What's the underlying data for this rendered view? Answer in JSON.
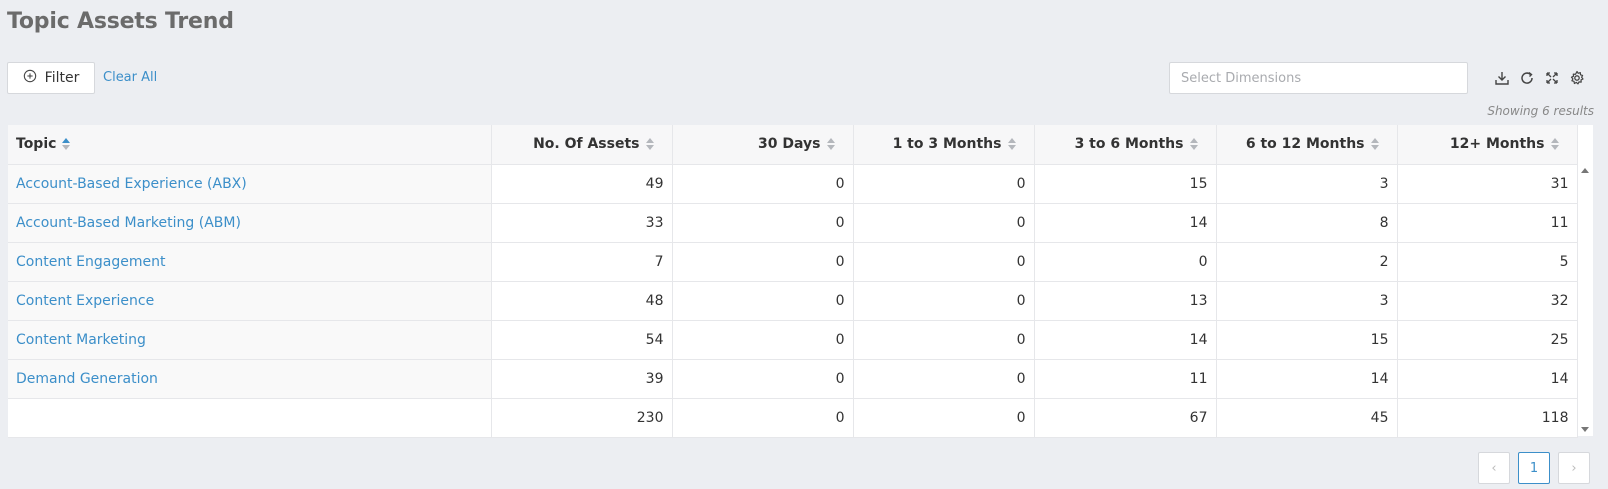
{
  "page": {
    "title": "Topic Assets Trend"
  },
  "toolbar": {
    "filter_label": "Filter",
    "clear_all_label": "Clear All",
    "dimensions_placeholder": "Select Dimensions",
    "icons": [
      "download-icon",
      "refresh-icon",
      "fullscreen-icon",
      "settings-icon"
    ]
  },
  "results": {
    "showing_text": "Showing 6 results"
  },
  "table": {
    "columns": [
      "Topic",
      "No. Of Assets",
      "30 Days",
      "1 to 3 Months",
      "3 to 6 Months",
      "6 to 12 Months",
      "12+ Months"
    ],
    "sorted_column": "Topic",
    "sort_direction": "ascending",
    "rows": [
      [
        "Account-Based Experience (ABX)",
        "49",
        "0",
        "0",
        "15",
        "3",
        "31"
      ],
      [
        "Account-Based Marketing (ABM)",
        "33",
        "0",
        "0",
        "14",
        "8",
        "11"
      ],
      [
        "Content Engagement",
        "7",
        "0",
        "0",
        "0",
        "2",
        "5"
      ],
      [
        "Content Experience",
        "48",
        "0",
        "0",
        "13",
        "3",
        "32"
      ],
      [
        "Content Marketing",
        "54",
        "0",
        "0",
        "14",
        "15",
        "25"
      ],
      [
        "Demand Generation",
        "39",
        "0",
        "0",
        "11",
        "14",
        "14"
      ]
    ],
    "totals": [
      "",
      "230",
      "0",
      "0",
      "67",
      "45",
      "118"
    ]
  },
  "pagination": {
    "current_page": "1",
    "prev_symbol": "‹",
    "next_symbol": "›"
  },
  "colors": {
    "accent": "#3c8fc9",
    "background": "#eceef2"
  }
}
